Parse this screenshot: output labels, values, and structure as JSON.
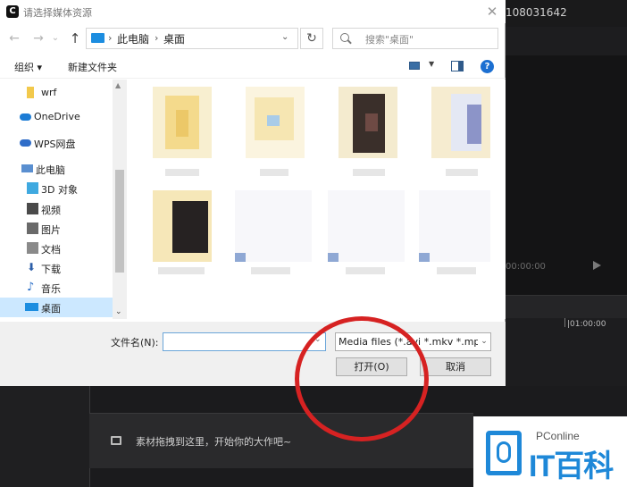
{
  "background_app": {
    "project_id": "108031642",
    "timecode": "00:00:00",
    "ruler_mark": "|01:00:00",
    "hint_text": "素材拖拽到这里，开始你的大作吧~"
  },
  "dialog": {
    "title": "请选择媒体资源",
    "app_icon_glyph": "C",
    "breadcrumb": [
      "此电脑",
      "桌面"
    ],
    "search_placeholder": "搜索\"桌面\"",
    "toolbar": {
      "organize": "组织 ▾",
      "new_folder": "新建文件夹"
    },
    "nav_items": [
      {
        "label": "wrf",
        "icon": "folder-icon"
      },
      {
        "label": "OneDrive",
        "icon": "cloud-icon"
      },
      {
        "label": "WPS网盘",
        "icon": "cloud-icon"
      },
      {
        "label": "此电脑",
        "icon": "computer-icon"
      },
      {
        "label": "3D 对象",
        "icon": "cube-icon"
      },
      {
        "label": "视频",
        "icon": "video-icon"
      },
      {
        "label": "图片",
        "icon": "picture-icon"
      },
      {
        "label": "文档",
        "icon": "document-icon"
      },
      {
        "label": "下载",
        "icon": "download-icon"
      },
      {
        "label": "音乐",
        "icon": "music-icon"
      },
      {
        "label": "桌面",
        "icon": "desktop-icon",
        "selected": true
      }
    ],
    "file_name_label": "文件名(N):",
    "file_name_value": "",
    "file_type_filter": "Media files (*.avi *.mkv *.mpg",
    "open_button": "打开(O)",
    "cancel_button": "取消"
  },
  "watermark": {
    "brand_small": "PConline",
    "brand_big": "IT百科"
  },
  "colors": {
    "accent": "#1c8de0",
    "selection": "#cce8ff",
    "highlight_circle": "#d62222"
  }
}
